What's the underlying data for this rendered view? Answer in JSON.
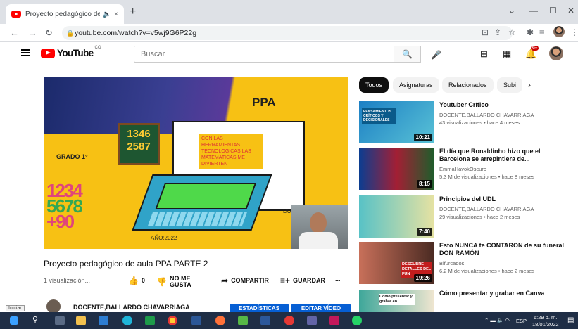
{
  "browser": {
    "tab_title": "Proyecto pedagógico de aul",
    "tab_audio_icon": "speaker-icon",
    "tab_close": "×",
    "new_tab": "+",
    "url": "youtube.com/watch?v=v5wj9G6P22g"
  },
  "youtube": {
    "logo": "YouTube",
    "logo_suffix": "CO",
    "search_placeholder": "Buscar",
    "notifications": "9+"
  },
  "video": {
    "slide": {
      "title": "PPA",
      "grade": "GRADO 1°",
      "board_numbers": "1346 2587",
      "callout": "CON LAS HERRAMIENTAS TECNOLOGICAS LAS MATEMATICAS ME DIVIERTEN",
      "year": "AÑO:2022",
      "corner_text": "DU UN"
    },
    "title": "Proyecto pedagógico de aula PPA PARTE 2",
    "views": "1 visualización...",
    "likes": "0",
    "dislike_label": "NO ME GUSTA",
    "share_label": "COMPARTIR",
    "save_label": "GUARDAR",
    "more": "...",
    "channel": "DOCENTE,BALLARDO CHAVARRIAGA",
    "stats_button": "ESTADÍSTICAS",
    "edit_button": "EDITAR VÍDEO"
  },
  "chips": [
    "Todos",
    "Asignaturas",
    "Relacionados",
    "Subi"
  ],
  "recommendations": [
    {
      "title": "Youtuber Crítico",
      "channel": "DOCENTE,BALLARDO CHAVARRIAGA",
      "meta": "43 visualizaciones • hace 4 meses",
      "duration": "10:21",
      "thumb_text": "PENSAMIENTOS CRÍTICOS Y DECISIONALES"
    },
    {
      "title": "El día que Ronaldinho hizo que el Barcelona se arrepintiera de...",
      "channel": "EmmaHavokOscuro",
      "meta": "5,3 M de visualizaciones • hace 8 meses",
      "duration": "8:15"
    },
    {
      "title": "Principios del UDL",
      "channel": "DOCENTE,BALLARDO CHAVARRIAGA",
      "meta": "29 visualizaciones • hace 2 meses",
      "duration": "7:40"
    },
    {
      "title": "Esto NUNCA te CONTARON de su funeral DON RAMÓN",
      "channel": "Bifurcados",
      "meta": "6,2 M de visualizaciones • hace 2 meses",
      "duration": "19:26",
      "thumb_text": "DESCUBRE DETALLES DEL FUN"
    },
    {
      "title": "Cómo presentar y grabar en Canva",
      "thumb_text": "Cómo presentar y grabar en"
    }
  ],
  "taskbar": {
    "tooltip": "Iniciar",
    "lang": "ESP",
    "time": "6:29 p. m.",
    "date": "18/01/2022"
  }
}
